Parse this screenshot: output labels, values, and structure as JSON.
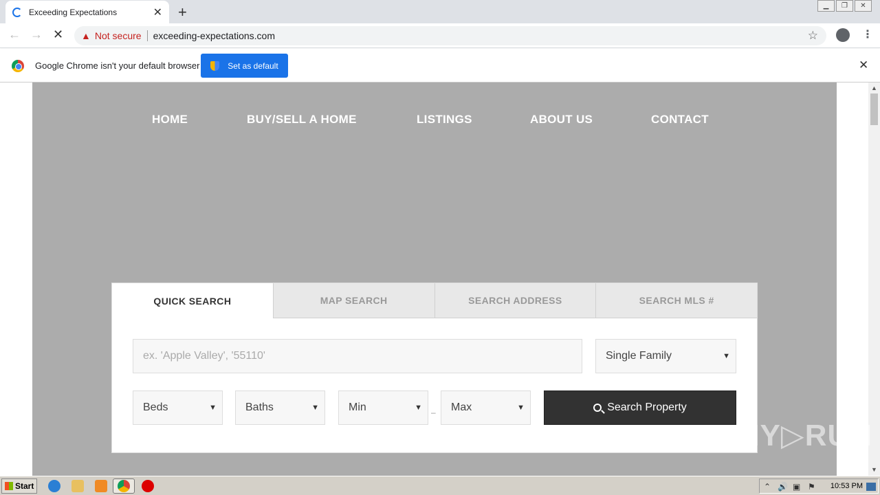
{
  "browser": {
    "tab_title": "Exceeding Expectations",
    "tab_close": "✕",
    "new_tab": "+",
    "security_label": "Not secure",
    "url": "exceeding-expectations.com"
  },
  "infobar": {
    "message": "Google Chrome isn't your default browser",
    "button_label": "Set as default",
    "close": "✕"
  },
  "site": {
    "nav": [
      "HOME",
      "BUY/SELL A HOME",
      "LISTINGS",
      "ABOUT US",
      "CONTACT"
    ],
    "search_tabs": [
      "QUICK SEARCH",
      "MAP SEARCH",
      "SEARCH ADDRESS",
      "SEARCH MLS #"
    ],
    "location_placeholder": "ex. 'Apple Valley', '55110'",
    "property_type": "Single Family",
    "beds": "Beds",
    "baths": "Baths",
    "min_price": "Min",
    "max_price": "Max",
    "range_dash": "–",
    "search_button": "Search Property"
  },
  "watermark": "ANY▷RUN",
  "taskbar": {
    "start_label": "Start",
    "clock": "10:53 PM"
  }
}
